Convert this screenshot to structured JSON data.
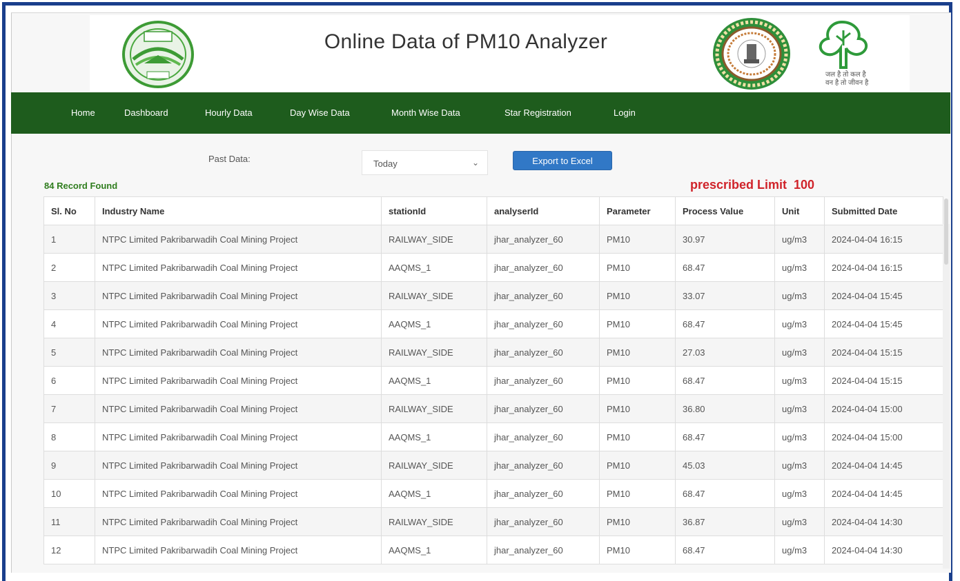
{
  "header": {
    "title": "Online Data of PM10 Analyzer",
    "tree_text_line1": "जल है तो कल है",
    "tree_text_line2": "वन है तो जीवन है"
  },
  "nav": {
    "items": [
      "Home",
      "Dashboard",
      "Hourly Data",
      "Day Wise Data",
      "Month Wise Data",
      "Star Registration",
      "Login"
    ]
  },
  "filter": {
    "past_label": "Past Data:",
    "selected": "Today",
    "export_label": "Export to Excel"
  },
  "records_found": "84 Record Found",
  "limit_text": "prescribed Limit  100",
  "colors": {
    "nav_bg": "#1e5c1d",
    "frame": "#1a3f8c",
    "limit": "#d0232a",
    "records": "#2f7d1e",
    "button": "#3178c6"
  },
  "table": {
    "columns": [
      "Sl. No",
      "Industry Name",
      "stationId",
      "analyserId",
      "Parameter",
      "Process Value",
      "Unit",
      "Submitted Date"
    ],
    "rows": [
      [
        "1",
        "NTPC Limited Pakribarwadih Coal Mining Project",
        "RAILWAY_SIDE",
        "jhar_analyzer_60",
        "PM10",
        "30.97",
        "ug/m3",
        "2024-04-04 16:15"
      ],
      [
        "2",
        "NTPC Limited Pakribarwadih Coal Mining Project",
        "AAQMS_1",
        "jhar_analyzer_60",
        "PM10",
        "68.47",
        "ug/m3",
        "2024-04-04 16:15"
      ],
      [
        "3",
        "NTPC Limited Pakribarwadih Coal Mining Project",
        "RAILWAY_SIDE",
        "jhar_analyzer_60",
        "PM10",
        "33.07",
        "ug/m3",
        "2024-04-04 15:45"
      ],
      [
        "4",
        "NTPC Limited Pakribarwadih Coal Mining Project",
        "AAQMS_1",
        "jhar_analyzer_60",
        "PM10",
        "68.47",
        "ug/m3",
        "2024-04-04 15:45"
      ],
      [
        "5",
        "NTPC Limited Pakribarwadih Coal Mining Project",
        "RAILWAY_SIDE",
        "jhar_analyzer_60",
        "PM10",
        "27.03",
        "ug/m3",
        "2024-04-04 15:15"
      ],
      [
        "6",
        "NTPC Limited Pakribarwadih Coal Mining Project",
        "AAQMS_1",
        "jhar_analyzer_60",
        "PM10",
        "68.47",
        "ug/m3",
        "2024-04-04 15:15"
      ],
      [
        "7",
        "NTPC Limited Pakribarwadih Coal Mining Project",
        "RAILWAY_SIDE",
        "jhar_analyzer_60",
        "PM10",
        "36.80",
        "ug/m3",
        "2024-04-04 15:00"
      ],
      [
        "8",
        "NTPC Limited Pakribarwadih Coal Mining Project",
        "AAQMS_1",
        "jhar_analyzer_60",
        "PM10",
        "68.47",
        "ug/m3",
        "2024-04-04 15:00"
      ],
      [
        "9",
        "NTPC Limited Pakribarwadih Coal Mining Project",
        "RAILWAY_SIDE",
        "jhar_analyzer_60",
        "PM10",
        "45.03",
        "ug/m3",
        "2024-04-04 14:45"
      ],
      [
        "10",
        "NTPC Limited Pakribarwadih Coal Mining Project",
        "AAQMS_1",
        "jhar_analyzer_60",
        "PM10",
        "68.47",
        "ug/m3",
        "2024-04-04 14:45"
      ],
      [
        "11",
        "NTPC Limited Pakribarwadih Coal Mining Project",
        "RAILWAY_SIDE",
        "jhar_analyzer_60",
        "PM10",
        "36.87",
        "ug/m3",
        "2024-04-04 14:30"
      ],
      [
        "12",
        "NTPC Limited Pakribarwadih Coal Mining Project",
        "AAQMS_1",
        "jhar_analyzer_60",
        "PM10",
        "68.47",
        "ug/m3",
        "2024-04-04 14:30"
      ]
    ]
  }
}
